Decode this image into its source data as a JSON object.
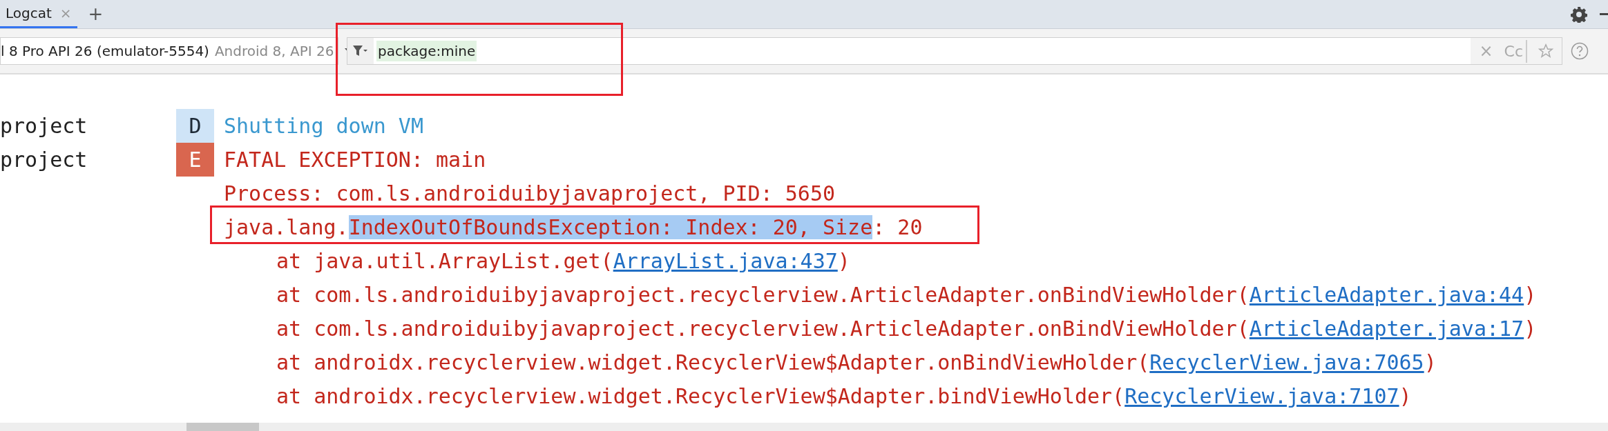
{
  "tabs": [
    {
      "label": "Logcat",
      "close": "×",
      "selected": true
    }
  ],
  "add_tab": "+",
  "device": {
    "name": "l 8 Pro API 26 (emulator-5554)",
    "detail": "Android 8, API 26"
  },
  "filter": {
    "value": "package:mine",
    "case_toggle": "Cc",
    "clear": "×"
  },
  "log": [
    {
      "tag": "project",
      "level": "D",
      "lines": [
        {
          "kind": "message",
          "segments": [
            {
              "kind": "plain",
              "text": "Shutting down VM"
            }
          ]
        }
      ]
    },
    {
      "tag": "project",
      "level": "E",
      "lines": [
        {
          "kind": "message",
          "segments": [
            {
              "kind": "plain",
              "text": "FATAL EXCEPTION: main"
            }
          ]
        },
        {
          "kind": "message",
          "segments": [
            {
              "kind": "plain",
              "text": "Process: com.ls.androiduibyjavaproject, PID: 5650"
            }
          ]
        },
        {
          "kind": "message",
          "segments": [
            {
              "kind": "plain",
              "text": "java.lang."
            },
            {
              "kind": "selected",
              "text": "IndexOutOfBoundsException: Index: 20, Size"
            },
            {
              "kind": "plain",
              "text": ": 20"
            }
          ]
        },
        {
          "kind": "frame",
          "segments": [
            {
              "kind": "plain",
              "text": "at java.util.ArrayList.get("
            },
            {
              "kind": "link",
              "text": "ArrayList.java:437"
            },
            {
              "kind": "plain",
              "text": ")"
            }
          ]
        },
        {
          "kind": "frame",
          "segments": [
            {
              "kind": "plain",
              "text": "at com.ls.androiduibyjavaproject.recyclerview.ArticleAdapter.onBindViewHolder("
            },
            {
              "kind": "link",
              "text": "ArticleAdapter.java:44"
            },
            {
              "kind": "plain",
              "text": ")"
            }
          ]
        },
        {
          "kind": "frame",
          "segments": [
            {
              "kind": "plain",
              "text": "at com.ls.androiduibyjavaproject.recyclerview.ArticleAdapter.onBindViewHolder("
            },
            {
              "kind": "link",
              "text": "ArticleAdapter.java:17"
            },
            {
              "kind": "plain",
              "text": ")"
            }
          ]
        },
        {
          "kind": "frame",
          "segments": [
            {
              "kind": "plain",
              "text": "at androidx.recyclerview.widget.RecyclerView$Adapter.onBindViewHolder("
            },
            {
              "kind": "link",
              "text": "RecyclerView.java:7065"
            },
            {
              "kind": "plain",
              "text": ")"
            }
          ]
        },
        {
          "kind": "frame",
          "segments": [
            {
              "kind": "plain",
              "text": "at androidx.recyclerview.widget.RecyclerView$Adapter.bindViewHolder("
            },
            {
              "kind": "link",
              "text": "RecyclerView.java:7107"
            },
            {
              "kind": "plain",
              "text": ")"
            }
          ]
        }
      ]
    }
  ]
}
